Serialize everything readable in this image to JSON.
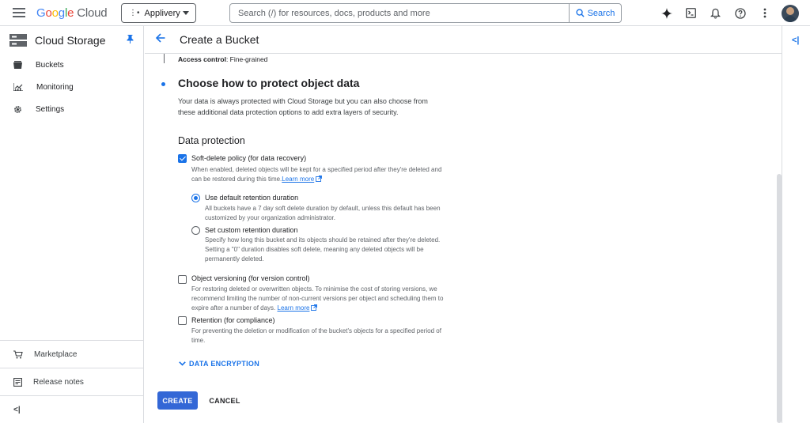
{
  "topbar": {
    "logo_parts": [
      "G",
      "o",
      "o",
      "g",
      "l",
      "e",
      " Cloud"
    ],
    "project_name": "Applivery",
    "search_placeholder": "Search (/) for resources, docs, products and more",
    "search_button": "Search",
    "icons": [
      "gemini-spark-icon",
      "cloud-shell-icon",
      "notifications-bell-icon",
      "help-icon",
      "more-vert-icon",
      "avatar"
    ]
  },
  "sidebar": {
    "title": "Cloud Storage",
    "items": [
      {
        "label": "Buckets",
        "icon": "bucket-icon"
      },
      {
        "label": "Monitoring",
        "icon": "chart-icon"
      },
      {
        "label": "Settings",
        "icon": "gear-icon"
      }
    ],
    "bottom_items": [
      {
        "label": "Marketplace",
        "icon": "cart-icon"
      },
      {
        "label": "Release notes",
        "icon": "notes-icon"
      }
    ],
    "collapse_glyph": "<|"
  },
  "main": {
    "header_title": "Create a Bucket",
    "access_control_key": "Access control",
    "access_control_value": ": Fine-grained",
    "step_title": "Choose how to protect object data",
    "step_desc": "Your data is always protected with Cloud Storage but you can also choose from these additional data protection options to add extra layers of security.",
    "section_title": "Data protection",
    "soft_delete": {
      "label": "Soft-delete policy (for data recovery)",
      "checked": true,
      "desc": "When enabled, deleted objects will be kept for a specified period after they're deleted and can be restored during this time.",
      "link": "Learn more"
    },
    "retention_default": {
      "label": "Use default retention duration",
      "selected": true,
      "desc": "All buckets have a 7 day soft delete duration by default, unless this default has been customized by your organization administrator."
    },
    "retention_custom": {
      "label": "Set custom retention duration",
      "selected": false,
      "desc": "Specify how long this bucket and its objects should be retained after they're deleted. Setting a \"0\" duration disables soft delete, meaning any deleted objects will be permanently deleted."
    },
    "versioning": {
      "label": "Object versioning (for version control)",
      "checked": false,
      "desc": "For restoring deleted or overwritten objects. To minimise the cost of storing versions, we recommend limiting the number of non-current versions per object and scheduling them to expire after a number of days.",
      "link": "Learn more"
    },
    "retention_compliance": {
      "label": "Retention (for compliance)",
      "checked": false,
      "desc": "For preventing the deletion or modification of the bucket's objects for a specified period of time."
    },
    "data_encryption": "DATA ENCRYPTION",
    "create_button": "CREATE",
    "cancel_button": "CANCEL"
  },
  "rightpanel": {
    "collapse_glyph": "<|"
  },
  "colors": {
    "accent": "#1a73e8",
    "create_bg": "#3367d6",
    "border": "#dadce0"
  }
}
